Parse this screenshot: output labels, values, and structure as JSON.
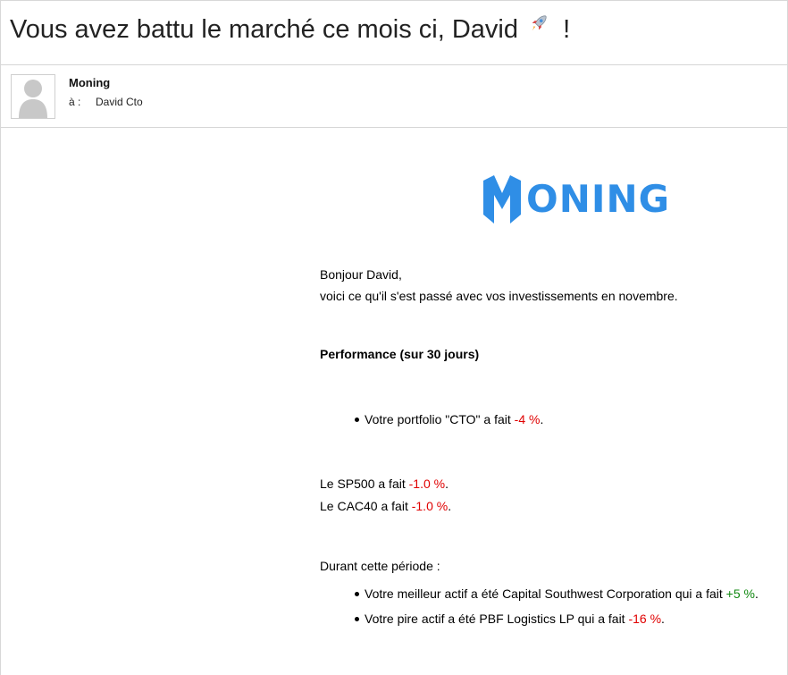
{
  "email": {
    "subject": "Vous avez battu le marché ce mois ci, David",
    "subject_end": "!",
    "subject_icon": "rocket-icon",
    "sender": "Moning",
    "to_prefix": "à :",
    "recipient": "David Cto"
  },
  "brand": {
    "logo_text": "ONING",
    "logo_letter": "M",
    "color": "#2f8ee6"
  },
  "content": {
    "greeting": "Bonjour David,",
    "intro": "voici ce qu'il s'est passé avec vos investissements en novembre.",
    "performance_heading": "Performance (sur 30 jours)",
    "portfolio_prefix": "Votre portfolio \"CTO\" a fait",
    "portfolio_value": "-4 %",
    "sp500_prefix": "Le SP500 a fait",
    "sp500_value": "-1.0 %",
    "cac40_prefix": "Le CAC40 a fait",
    "cac40_value": "-1.0 %",
    "period_heading": "Durant cette période :",
    "best_prefix": "Votre meilleur actif a été Capital Southwest Corporation qui a fait",
    "best_value": "+5 %",
    "worst_prefix": "Votre pire actif a été PBF Logistics LP qui a fait",
    "worst_value": "-16 %",
    "period_char": ".",
    "negative_color": "#e00000",
    "positive_color": "#118811"
  }
}
